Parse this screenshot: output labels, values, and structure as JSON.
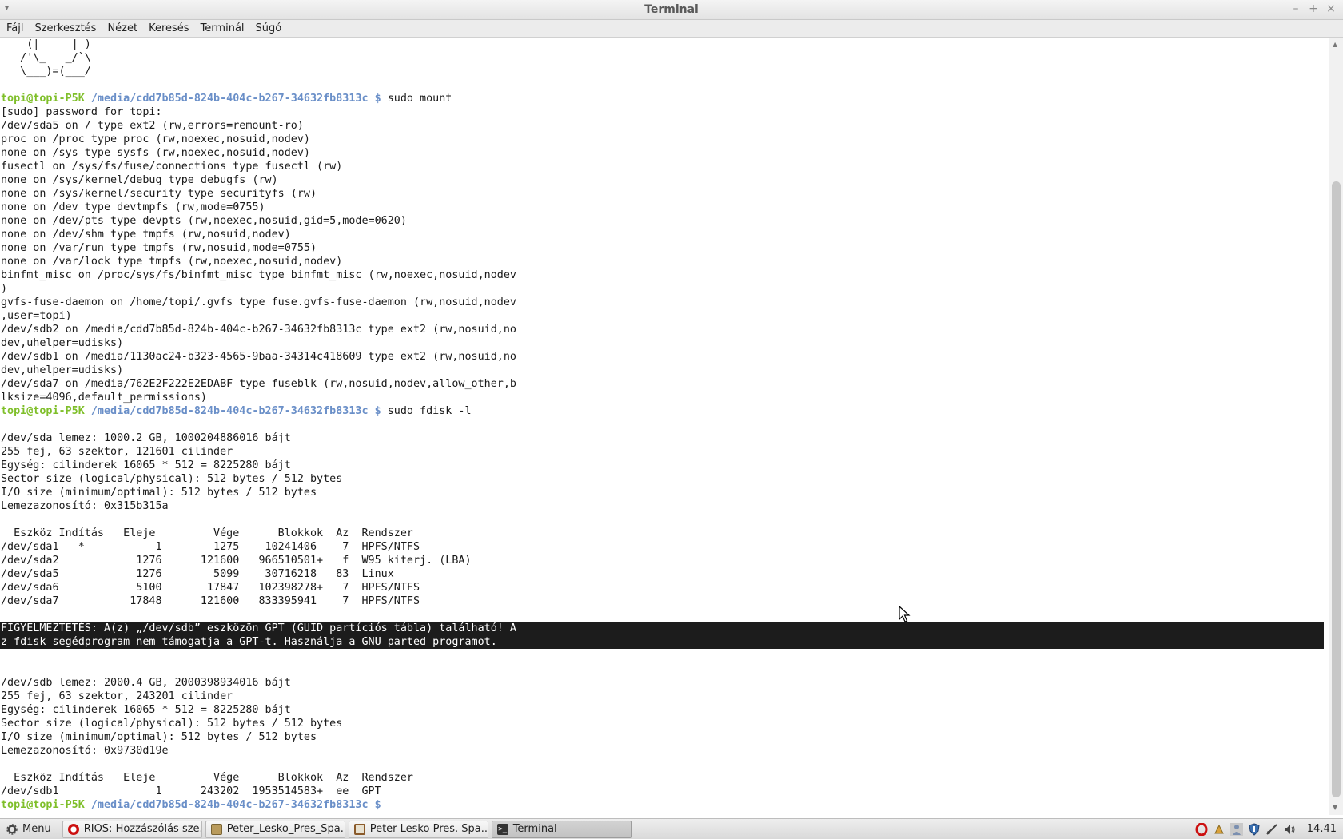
{
  "window": {
    "title": "Terminal",
    "menu": [
      "Fájl",
      "Szerkesztés",
      "Nézet",
      "Keresés",
      "Terminál",
      "Súgó"
    ]
  },
  "prompt": {
    "user": "topi@topi-P5K",
    "path": "/media/cdd7b85d-824b-404c-b267-34632fb8313c",
    "symbol": "$"
  },
  "terminal": [
    {
      "t": "    (|     | )"
    },
    {
      "t": "   /'\\_   _/`\\"
    },
    {
      "t": "   \\___)=(___/"
    },
    {
      "t": ""
    },
    {
      "prompt": true,
      "cmd": "sudo mount"
    },
    {
      "t": "[sudo] password for topi:"
    },
    {
      "t": "/dev/sda5 on / type ext2 (rw,errors=remount-ro)"
    },
    {
      "t": "proc on /proc type proc (rw,noexec,nosuid,nodev)"
    },
    {
      "t": "none on /sys type sysfs (rw,noexec,nosuid,nodev)"
    },
    {
      "t": "fusectl on /sys/fs/fuse/connections type fusectl (rw)"
    },
    {
      "t": "none on /sys/kernel/debug type debugfs (rw)"
    },
    {
      "t": "none on /sys/kernel/security type securityfs (rw)"
    },
    {
      "t": "none on /dev type devtmpfs (rw,mode=0755)"
    },
    {
      "t": "none on /dev/pts type devpts (rw,noexec,nosuid,gid=5,mode=0620)"
    },
    {
      "t": "none on /dev/shm type tmpfs (rw,nosuid,nodev)"
    },
    {
      "t": "none on /var/run type tmpfs (rw,nosuid,mode=0755)"
    },
    {
      "t": "none on /var/lock type tmpfs (rw,noexec,nosuid,nodev)"
    },
    {
      "t": "binfmt_misc on /proc/sys/fs/binfmt_misc type binfmt_misc (rw,noexec,nosuid,nodev"
    },
    {
      "t": ")"
    },
    {
      "t": "gvfs-fuse-daemon on /home/topi/.gvfs type fuse.gvfs-fuse-daemon (rw,nosuid,nodev"
    },
    {
      "t": ",user=topi)"
    },
    {
      "t": "/dev/sdb2 on /media/cdd7b85d-824b-404c-b267-34632fb8313c type ext2 (rw,nosuid,no"
    },
    {
      "t": "dev,uhelper=udisks)"
    },
    {
      "t": "/dev/sdb1 on /media/1130ac24-b323-4565-9baa-34314c418609 type ext2 (rw,nosuid,no"
    },
    {
      "t": "dev,uhelper=udisks)"
    },
    {
      "t": "/dev/sda7 on /media/762E2F222E2EDABF type fuseblk (rw,nosuid,nodev,allow_other,b"
    },
    {
      "t": "lksize=4096,default_permissions)"
    },
    {
      "prompt": true,
      "cmd": "sudo fdisk -l"
    },
    {
      "t": ""
    },
    {
      "t": "/dev/sda lemez: 1000.2 GB, 1000204886016 bájt"
    },
    {
      "t": "255 fej, 63 szektor, 121601 cilinder"
    },
    {
      "t": "Egység: cilinderek 16065 * 512 = 8225280 bájt"
    },
    {
      "t": "Sector size (logical/physical): 512 bytes / 512 bytes"
    },
    {
      "t": "I/O size (minimum/optimal): 512 bytes / 512 bytes"
    },
    {
      "t": "Lemezazonosító: 0x315b315a"
    },
    {
      "t": ""
    },
    {
      "t": "  Eszköz Indítás   Eleje         Vége      Blokkok  Az  Rendszer"
    },
    {
      "t": "/dev/sda1   *           1        1275    10241406    7  HPFS/NTFS"
    },
    {
      "t": "/dev/sda2            1276      121600   966510501+   f  W95 kiterj. (LBA)"
    },
    {
      "t": "/dev/sda5            1276        5099    30716218   83  Linux"
    },
    {
      "t": "/dev/sda6            5100       17847   102398278+   7  HPFS/NTFS"
    },
    {
      "t": "/dev/sda7           17848      121600   833395941    7  HPFS/NTFS"
    },
    {
      "t": ""
    },
    {
      "hl": true,
      "t": "FIGYELMEZTETÉS: A(z) „/dev/sdb” eszközön GPT (GUID partíciós tábla) található! A"
    },
    {
      "hl": true,
      "t": "z fdisk segédprogram nem támogatja a GPT-t. Használja a GNU parted programot."
    },
    {
      "t": ""
    },
    {
      "t": ""
    },
    {
      "t": "/dev/sdb lemez: 2000.4 GB, 2000398934016 bájt"
    },
    {
      "t": "255 fej, 63 szektor, 243201 cilinder"
    },
    {
      "t": "Egység: cilinderek 16065 * 512 = 8225280 bájt"
    },
    {
      "t": "Sector size (logical/physical): 512 bytes / 512 bytes"
    },
    {
      "t": "I/O size (minimum/optimal): 512 bytes / 512 bytes"
    },
    {
      "t": "Lemezazonosító: 0x9730d19e"
    },
    {
      "t": ""
    },
    {
      "t": "  Eszköz Indítás   Eleje         Vége      Blokkok  Az  Rendszer"
    },
    {
      "t": "/dev/sdb1               1      243202  1953514583+  ee  GPT"
    },
    {
      "prompt": true,
      "cmd": ""
    }
  ],
  "taskbar": {
    "menu_label": "Menu",
    "tasks": [
      {
        "label": "RIOS: Hozzászólás sze...",
        "icon": "opera-icon",
        "color": "#cc1010"
      },
      {
        "label": "Peter_Lesko_Pres_Spa...",
        "icon": "folder-icon",
        "color": "#b99b5c"
      },
      {
        "label": "Peter Lesko Pres. Spa...",
        "icon": "presentation-icon",
        "color": "#8a5a2a"
      },
      {
        "label": "Terminal",
        "icon": "terminal-icon",
        "color": "#333333"
      }
    ],
    "clock": "14.41"
  },
  "colors": {
    "prompt_user": "#7fbf2a",
    "prompt_path": "#6a8fc8",
    "highlight_bg": "#1c1c1c"
  }
}
